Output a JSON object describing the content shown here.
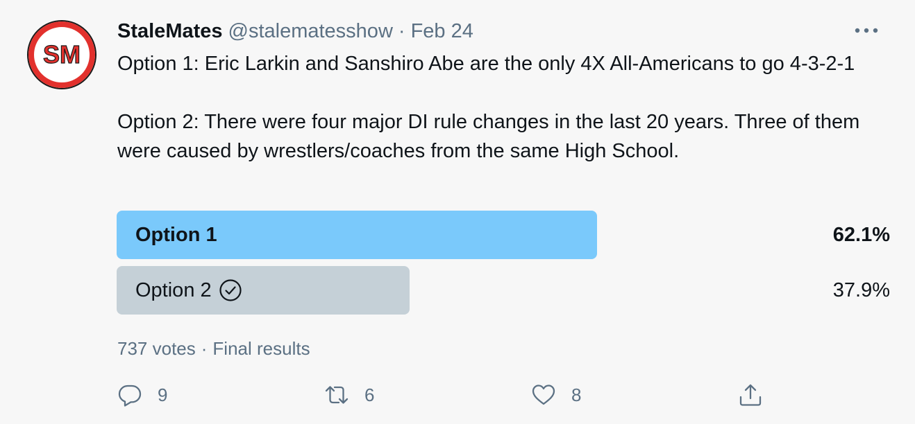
{
  "tweet": {
    "author_name": "StaleMates",
    "handle": "@stalematesshow",
    "separator": "·",
    "date": "Feb 24",
    "avatar_initials": "SM",
    "text_paragraphs": [
      "Option 1: Eric Larkin and Sanshiro Abe are the only 4X All-Americans to go 4-3-2-1",
      "Option 2: There were four major DI rule changes in the last 20 years. Three of them were caused by wrestlers/coaches from the same High School."
    ]
  },
  "poll": {
    "options": [
      {
        "label": "Option 1",
        "percent_text": "62.1%",
        "percent": 62.1,
        "leading": true,
        "voted": false,
        "bar_color": "#7ac9fb"
      },
      {
        "label": "Option 2",
        "percent_text": "37.9%",
        "percent": 37.9,
        "leading": false,
        "voted": true,
        "bar_color": "#c5d0d7"
      }
    ],
    "votes": "737 votes",
    "separator": "·",
    "status": "Final results"
  },
  "actions": {
    "reply_count": "9",
    "retweet_count": "6",
    "like_count": "8"
  },
  "icons": {
    "more": "more-horizontal-icon",
    "reply": "reply-icon",
    "retweet": "retweet-icon",
    "like": "heart-icon",
    "share": "share-icon",
    "voted": "check-circle-icon"
  },
  "colors": {
    "text_primary": "#0f1419",
    "text_secondary": "#5b7083",
    "background": "#f7f7f7",
    "avatar_red": "#e2312d"
  }
}
